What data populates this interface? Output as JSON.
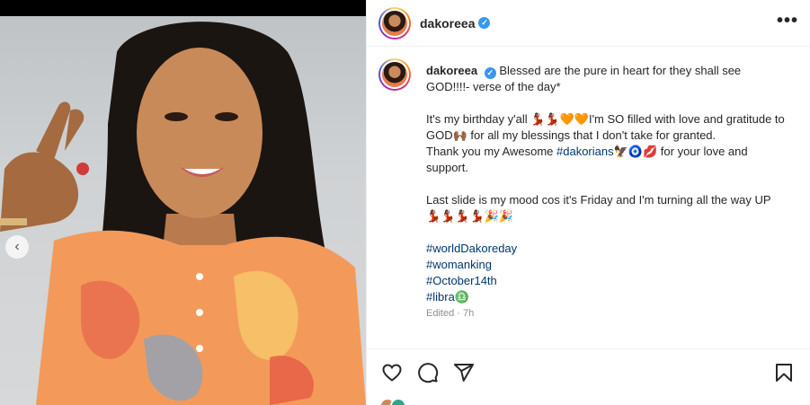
{
  "post": {
    "username": "dakoreea",
    "verified_mark": "✓",
    "more_label": "•••",
    "caption_lines": [
      "Blessed are the pure in heart for they shall see GOD!!!!- verse of the day*",
      "It's my birthday y'all 💃🏾💃🏾🧡🧡I'm SO filled with love and gratitude to GOD🙌🏾 for all my blessings that I don't take for granted.",
      "Thank you my Awesome ",
      "🦅🧿💋 for your love and support.",
      "Last slide is my mood cos it's Friday and I'm turning all the way UP 💃🏾💃🏾💃🏾💃🏾🎉🎉"
    ],
    "mention_tag": "#dakorians",
    "hashtags": [
      "#worldDakoreday",
      "#womanking",
      "#October14th",
      "#libra"
    ],
    "libra_emoji": "♎",
    "edited": "Edited · 7h"
  },
  "icons": {
    "heart": "heart-icon",
    "comment": "comment-icon",
    "share": "share-icon",
    "bookmark": "bookmark-icon",
    "prev": "chevron-left-icon"
  },
  "colors": {
    "link": "#00376b",
    "verified": "#3897f0",
    "muted": "#8e8e8e"
  }
}
